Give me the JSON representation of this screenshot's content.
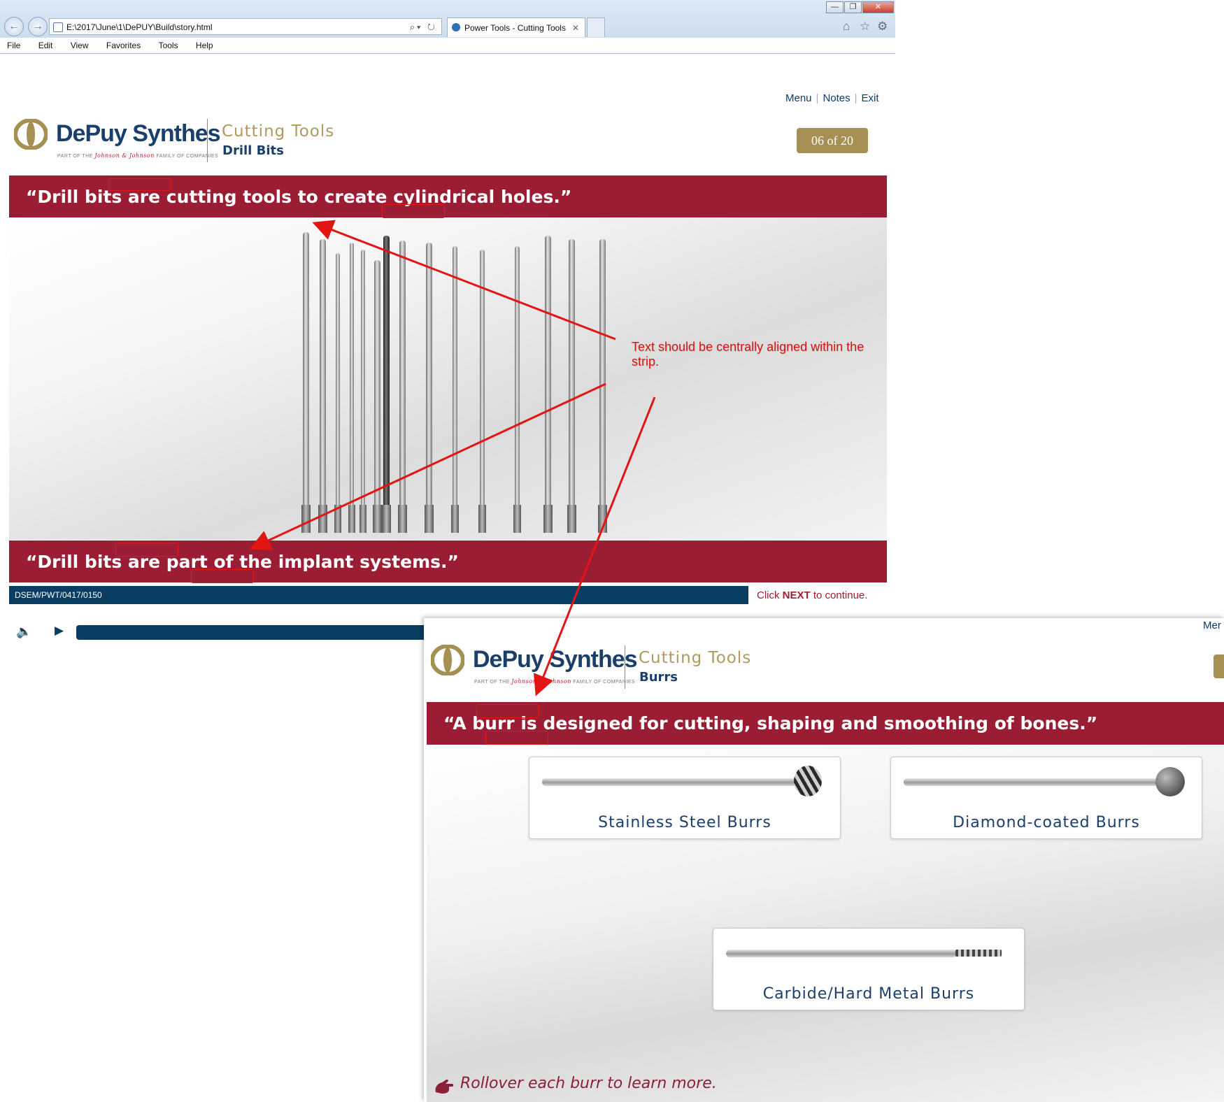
{
  "browser": {
    "address": "E:\\2017\\June\\1\\DePUY\\Build\\story.html",
    "tab_title": "Power Tools - Cutting Tools",
    "menu": [
      "File",
      "Edit",
      "View",
      "Favorites",
      "Tools",
      "Help"
    ],
    "window_buttons": [
      "—",
      "❐",
      "✕"
    ]
  },
  "slide1": {
    "top_links": [
      "Menu",
      "Notes",
      "Exit"
    ],
    "brand": "DePuy Synthes",
    "tagline_pre": "PART OF THE",
    "tagline_jj": "Johnson & Johnson",
    "tagline_post": "FAMILY OF COMPANIES",
    "course_title": "Cutting Tools",
    "section": "Drill Bits",
    "counter": "06 of 20",
    "quote_top": "“Drill bits are cutting tools to create cylindrical holes.”",
    "quote_bottom": "“Drill bits are part of the implant systems.”",
    "code": "DSEM/PWT/0417/0150",
    "next_pre": "Click",
    "next_bold": "NEXT",
    "next_post": "to continue."
  },
  "annotation": {
    "note": "Text should be centrally aligned within the strip.",
    "color": "#d61313"
  },
  "slide2": {
    "top_link_partial": "Mer",
    "brand": "DePuy Synthes",
    "tagline_pre": "PART OF THE",
    "tagline_jj": "Johnson & Johnson",
    "tagline_post": "FAMILY OF COMPANIES",
    "course_title": "Cutting Tools",
    "section": "Burrs",
    "quote": "“A burr is designed for cutting, shaping and smoothing of bones.”",
    "cards": [
      {
        "label": "Stainless Steel Burrs"
      },
      {
        "label": "Diamond-coated Burrs"
      },
      {
        "label": "Carbide/Hard Metal Burrs"
      }
    ],
    "rollover": "Rollover each burr to learn more."
  },
  "colors": {
    "strip": "#9a1d33",
    "navy": "#0a3d62",
    "gold": "#a58f52"
  }
}
